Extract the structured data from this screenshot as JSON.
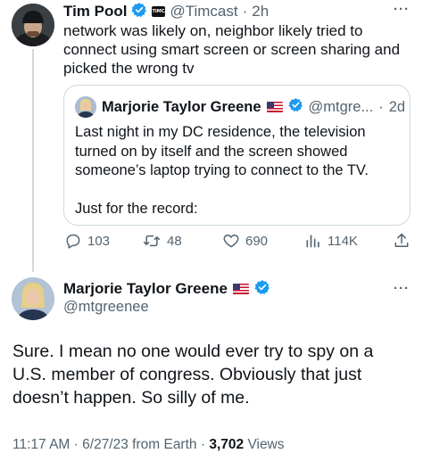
{
  "tweet1": {
    "name": "Tim Pool",
    "badge": "TIMCAST",
    "handle": "@Timcast",
    "separator": "·",
    "time": "2h",
    "text": "network was likely on, neighbor likely tried to connect using smart screen or screen sharing and picked the wrong tv"
  },
  "quoted": {
    "name": "Marjorie Taylor Greene",
    "handle": "@mtgre...",
    "separator": "·",
    "time": "2d",
    "paragraph1": "Last night in my DC residence, the television turned on by itself and the screen showed someone’s laptop trying to connect to the TV.",
    "paragraph2": "Just for the record:"
  },
  "actions": {
    "replies": "103",
    "retweets": "48",
    "likes": "690",
    "views": "114K"
  },
  "tweet2": {
    "name": "Marjorie Taylor Greene",
    "handle": "@mtgreenee",
    "text": "Sure. I mean no one would ever try to spy on a U.S. member of congress. Obviously that just doesn’t happen. So silly of me.",
    "time": "11:17 AM",
    "dot1": "·",
    "date": "6/27/23",
    "source": "from Earth",
    "dot2": "·",
    "views_count": "3,702",
    "views_label": "Views"
  },
  "more_label": "···",
  "icons": [
    "reply-icon",
    "retweet-icon",
    "like-icon",
    "views-icon",
    "share-icon",
    "verified-icon",
    "us-flag-icon",
    "more-icon"
  ],
  "colors": {
    "verified": "#1d9bf0",
    "muted": "#536471",
    "text": "#0f1419",
    "border": "#cfd9de"
  }
}
